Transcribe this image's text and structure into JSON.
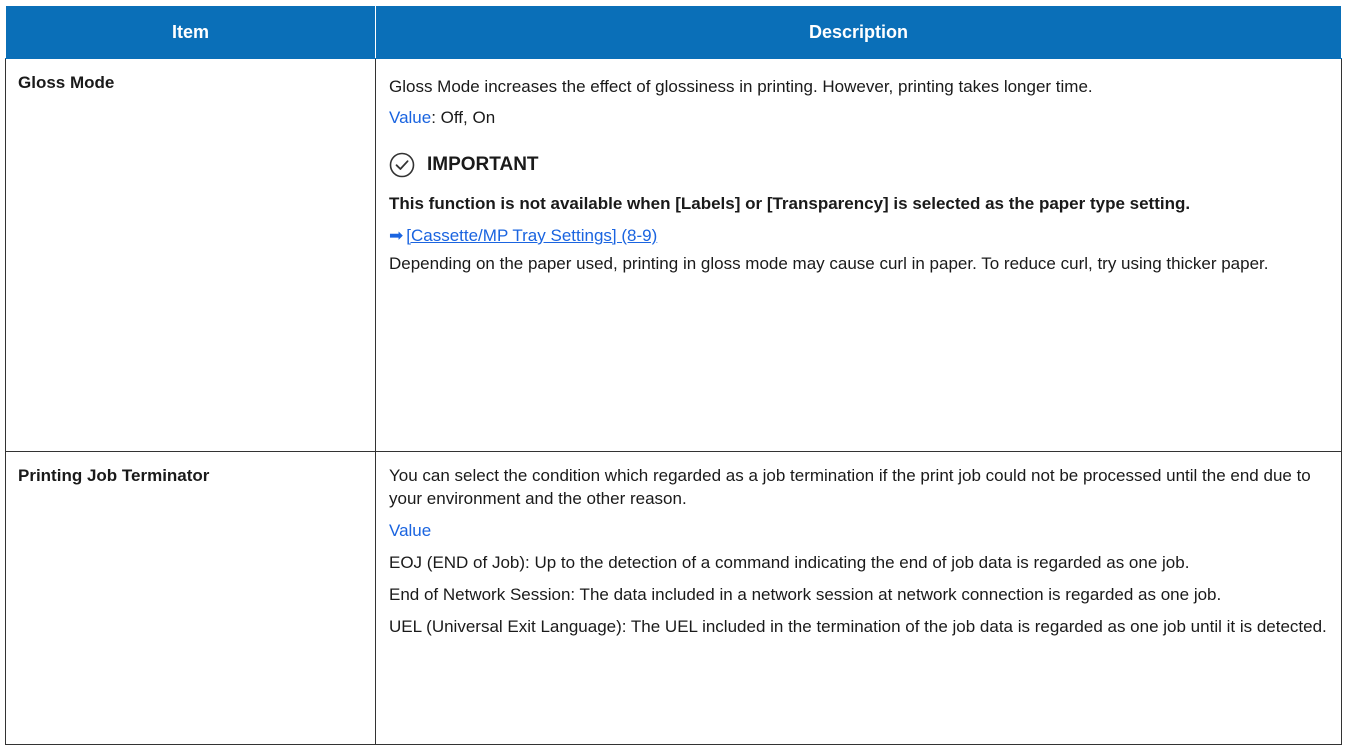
{
  "table": {
    "headers": {
      "item": "Item",
      "description": "Description"
    },
    "rows": [
      {
        "item": "Gloss Mode",
        "description": {
          "intro": "Gloss Mode increases the effect of glossiness in printing. However, printing takes longer time.",
          "value_label": "Value",
          "value_text": ": Off, On",
          "important_label": "IMPORTANT",
          "important_text": "This function is not available when [Labels] or [Transparency] is selected as the paper type setting.",
          "crossref": "[Cassette/MP Tray Settings] (8-9)",
          "note": "Depending on the paper used, printing in gloss mode may cause curl in paper. To reduce curl, try using thicker paper."
        }
      },
      {
        "item": "Printing Job Terminator",
        "description": {
          "intro": "You can select the condition which regarded as a job termination if the print job could not be processed until the end due to your environment and the other reason.",
          "value_label": "Value",
          "options": [
            "EOJ (END of Job): Up to the detection of a command indicating the end of job data is regarded as one job.",
            "End of Network Session: The data included in a network session at network connection is regarded as one job.",
            "UEL (Universal Exit Language): The UEL included in the termination of the job data is regarded as one job until it is detected."
          ]
        }
      }
    ]
  },
  "colors": {
    "header_bg": "#0a6fb8",
    "link": "#1a64e0",
    "border": "#333333"
  },
  "icons": {
    "important": "check-circle-icon",
    "crossref": "right-arrow-icon"
  }
}
